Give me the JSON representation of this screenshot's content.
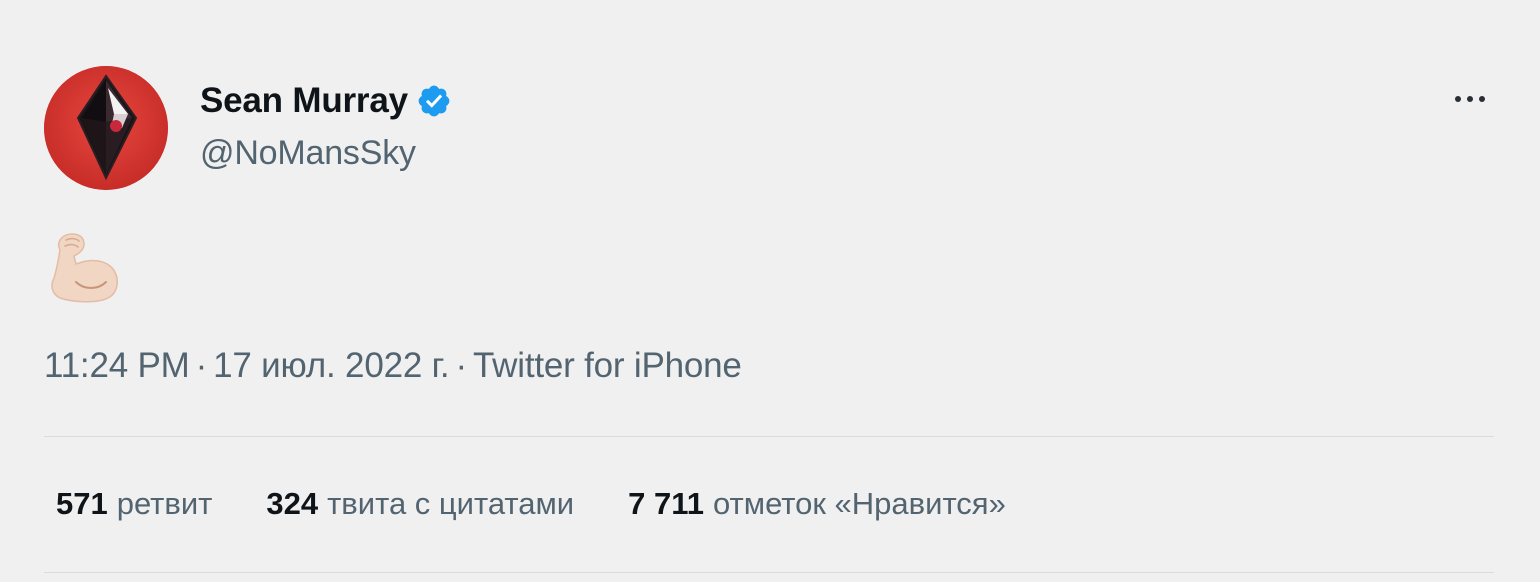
{
  "author": {
    "display_name": "Sean Murray",
    "handle": "@NoMansSky",
    "verified": true,
    "avatar_icon": "no-mans-sky-logo-icon"
  },
  "tweet": {
    "body_emoji": "flexed-biceps-icon",
    "time": "11:24 PM",
    "date": "17 июл. 2022 г.",
    "source": "Twitter for iPhone",
    "separator": "·"
  },
  "stats": [
    {
      "count": "571",
      "label": "ретвит"
    },
    {
      "count": "324",
      "label": "твита с цитатами"
    },
    {
      "count": "7 711",
      "label": "отметок «Нравится»"
    }
  ],
  "colors": {
    "background": "#f0f0f0",
    "verified_blue": "#1d9bf0",
    "secondary_text": "#536471",
    "primary_text": "#0f1419",
    "avatar_red": "#d3342d"
  }
}
